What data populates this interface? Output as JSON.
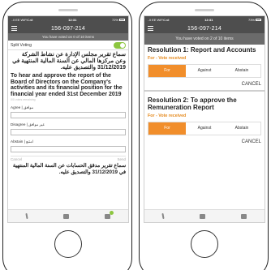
{
  "left": {
    "status": {
      "carrier": "..ll EE WiFiCall",
      "time": "12:31",
      "battery": "72%"
    },
    "title": "156-097-214",
    "banner": "You have voted on 0 of 10 items",
    "split_label": "Split Voting",
    "arabic_heading": "سماع تقرير مجلس الإدارة عن نشاط الشركة وعن مركزها المالي عن السنة المالية المنتهية في 31/12/2019 والتصديق عليه.",
    "english_heading": "To hear and approve the report of the Board of Directors on the Company's activities and its financial position for the financial year ended 31st December 2019",
    "faint_note": "0/0 votes remaining",
    "fields": [
      {
        "label": "Agree | موافق"
      },
      {
        "label": "Disagree | غير موافق"
      },
      {
        "label": "Abstain | امتنع"
      }
    ],
    "cancel": "Cancel",
    "send": "Send",
    "arabic_heading2": "سماع تقرير مدقق الحسابات عن السنة المالية المنتهية في 31/12/2019 والتصديق عليه."
  },
  "right": {
    "status": {
      "carrier": "..ll EE WiFiCall",
      "time": "12:31",
      "battery": "73%"
    },
    "title": "156-097-214",
    "banner": "You have voted on 2 of 10 items",
    "resolutions": [
      {
        "title": "Resolution 1: Report and Accounts",
        "status": "For - Vote received",
        "options": [
          "For",
          "Against",
          "Abstain"
        ],
        "cancel": "CANCEL"
      },
      {
        "title": "Resolution 2: To approve the Remuneration Report",
        "status": "For - Vote received",
        "options": [
          "For",
          "Against",
          "Abstain"
        ],
        "cancel": "CANCEL"
      }
    ]
  },
  "colors": {
    "accent": "#f18e2b",
    "toggle": "#8cc63f",
    "bar": "#4e4e4e",
    "status_text": "#e58a1e"
  },
  "icons": {
    "menu": "hamburger-icon",
    "tab1": "info-icon",
    "tab2": "chat-icon",
    "tab3": "document-icon"
  }
}
